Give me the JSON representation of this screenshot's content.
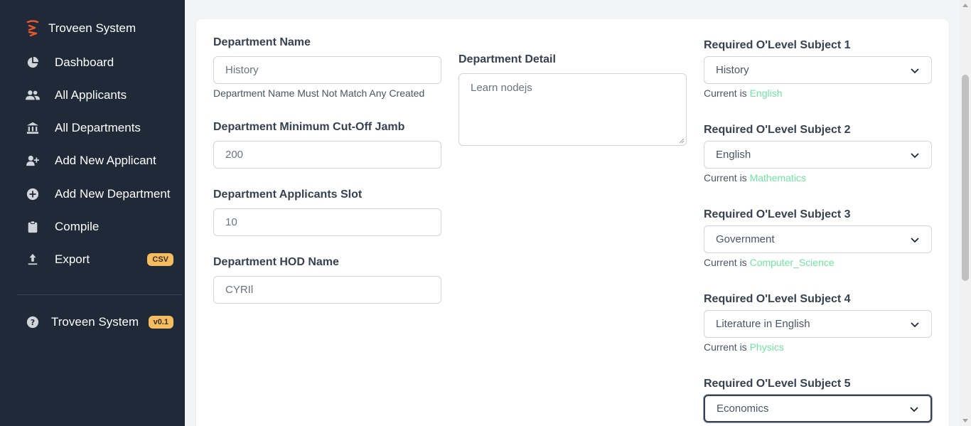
{
  "sidebar": {
    "brand": "Troveen System",
    "items": [
      {
        "label": "Dashboard",
        "icon": "pie-chart-icon"
      },
      {
        "label": "All Applicants",
        "icon": "users-icon"
      },
      {
        "label": "All Departments",
        "icon": "institution-icon"
      },
      {
        "label": "Add New Applicant",
        "icon": "user-plus-icon"
      },
      {
        "label": "Add New Department",
        "icon": "plus-circle-icon"
      },
      {
        "label": "Compile",
        "icon": "clipboard-icon"
      },
      {
        "label": "Export",
        "icon": "upload-icon",
        "badge": "CSV"
      }
    ],
    "footer": {
      "label": "Troveen System",
      "icon": "help-icon",
      "badge": "v0.1"
    }
  },
  "form": {
    "dept_name": {
      "label": "Department Name",
      "value": "History",
      "hint": "Department Name Must Not Match Any Created"
    },
    "cutoff": {
      "label": "Department Minimum Cut-Off Jamb",
      "value": "200"
    },
    "slot": {
      "label": "Department Applicants Slot",
      "value": "10"
    },
    "hod": {
      "label": "Department HOD Name",
      "value": "CYRIl"
    },
    "detail": {
      "label": "Department Detail",
      "value": "Learn nodejs"
    },
    "subjects": [
      {
        "label": "Required O'Level Subject 1",
        "value": "History",
        "current_prefix": "Current is ",
        "current": "English"
      },
      {
        "label": "Required O'Level Subject 2",
        "value": "English",
        "current_prefix": "Current is ",
        "current": "Mathematics"
      },
      {
        "label": "Required O'Level Subject 3",
        "value": "Government",
        "current_prefix": "Current is ",
        "current": "Computer_Science"
      },
      {
        "label": "Required O'Level Subject 4",
        "value": "Literature in English",
        "current_prefix": "Current is ",
        "current": "Physics"
      },
      {
        "label": "Required O'Level Subject 5",
        "value": "Economics"
      }
    ]
  },
  "colors": {
    "sidebar_bg": "#1f2937",
    "badge": "#f6bd60",
    "accent_green": "#6ee7a0",
    "brand_red": "#e4572e"
  }
}
